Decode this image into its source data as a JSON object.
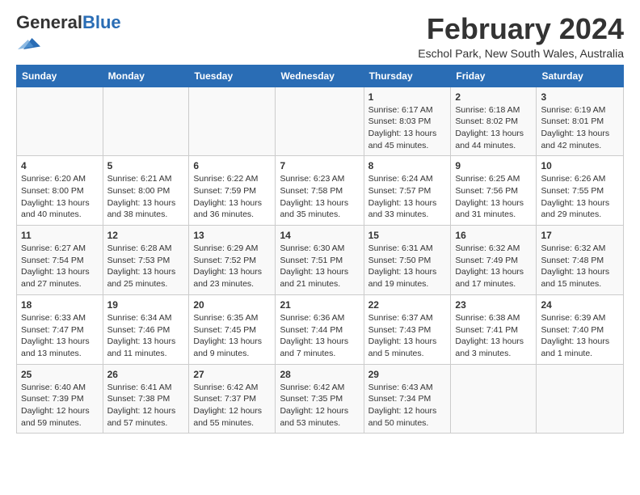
{
  "logo": {
    "general": "General",
    "blue": "Blue"
  },
  "title": {
    "month": "February 2024",
    "location": "Eschol Park, New South Wales, Australia"
  },
  "headers": [
    "Sunday",
    "Monday",
    "Tuesday",
    "Wednesday",
    "Thursday",
    "Friday",
    "Saturday"
  ],
  "weeks": [
    [
      {
        "day": "",
        "info": ""
      },
      {
        "day": "",
        "info": ""
      },
      {
        "day": "",
        "info": ""
      },
      {
        "day": "",
        "info": ""
      },
      {
        "day": "1",
        "info": "Sunrise: 6:17 AM\nSunset: 8:03 PM\nDaylight: 13 hours\nand 45 minutes."
      },
      {
        "day": "2",
        "info": "Sunrise: 6:18 AM\nSunset: 8:02 PM\nDaylight: 13 hours\nand 44 minutes."
      },
      {
        "day": "3",
        "info": "Sunrise: 6:19 AM\nSunset: 8:01 PM\nDaylight: 13 hours\nand 42 minutes."
      }
    ],
    [
      {
        "day": "4",
        "info": "Sunrise: 6:20 AM\nSunset: 8:00 PM\nDaylight: 13 hours\nand 40 minutes."
      },
      {
        "day": "5",
        "info": "Sunrise: 6:21 AM\nSunset: 8:00 PM\nDaylight: 13 hours\nand 38 minutes."
      },
      {
        "day": "6",
        "info": "Sunrise: 6:22 AM\nSunset: 7:59 PM\nDaylight: 13 hours\nand 36 minutes."
      },
      {
        "day": "7",
        "info": "Sunrise: 6:23 AM\nSunset: 7:58 PM\nDaylight: 13 hours\nand 35 minutes."
      },
      {
        "day": "8",
        "info": "Sunrise: 6:24 AM\nSunset: 7:57 PM\nDaylight: 13 hours\nand 33 minutes."
      },
      {
        "day": "9",
        "info": "Sunrise: 6:25 AM\nSunset: 7:56 PM\nDaylight: 13 hours\nand 31 minutes."
      },
      {
        "day": "10",
        "info": "Sunrise: 6:26 AM\nSunset: 7:55 PM\nDaylight: 13 hours\nand 29 minutes."
      }
    ],
    [
      {
        "day": "11",
        "info": "Sunrise: 6:27 AM\nSunset: 7:54 PM\nDaylight: 13 hours\nand 27 minutes."
      },
      {
        "day": "12",
        "info": "Sunrise: 6:28 AM\nSunset: 7:53 PM\nDaylight: 13 hours\nand 25 minutes."
      },
      {
        "day": "13",
        "info": "Sunrise: 6:29 AM\nSunset: 7:52 PM\nDaylight: 13 hours\nand 23 minutes."
      },
      {
        "day": "14",
        "info": "Sunrise: 6:30 AM\nSunset: 7:51 PM\nDaylight: 13 hours\nand 21 minutes."
      },
      {
        "day": "15",
        "info": "Sunrise: 6:31 AM\nSunset: 7:50 PM\nDaylight: 13 hours\nand 19 minutes."
      },
      {
        "day": "16",
        "info": "Sunrise: 6:32 AM\nSunset: 7:49 PM\nDaylight: 13 hours\nand 17 minutes."
      },
      {
        "day": "17",
        "info": "Sunrise: 6:32 AM\nSunset: 7:48 PM\nDaylight: 13 hours\nand 15 minutes."
      }
    ],
    [
      {
        "day": "18",
        "info": "Sunrise: 6:33 AM\nSunset: 7:47 PM\nDaylight: 13 hours\nand 13 minutes."
      },
      {
        "day": "19",
        "info": "Sunrise: 6:34 AM\nSunset: 7:46 PM\nDaylight: 13 hours\nand 11 minutes."
      },
      {
        "day": "20",
        "info": "Sunrise: 6:35 AM\nSunset: 7:45 PM\nDaylight: 13 hours\nand 9 minutes."
      },
      {
        "day": "21",
        "info": "Sunrise: 6:36 AM\nSunset: 7:44 PM\nDaylight: 13 hours\nand 7 minutes."
      },
      {
        "day": "22",
        "info": "Sunrise: 6:37 AM\nSunset: 7:43 PM\nDaylight: 13 hours\nand 5 minutes."
      },
      {
        "day": "23",
        "info": "Sunrise: 6:38 AM\nSunset: 7:41 PM\nDaylight: 13 hours\nand 3 minutes."
      },
      {
        "day": "24",
        "info": "Sunrise: 6:39 AM\nSunset: 7:40 PM\nDaylight: 13 hours\nand 1 minute."
      }
    ],
    [
      {
        "day": "25",
        "info": "Sunrise: 6:40 AM\nSunset: 7:39 PM\nDaylight: 12 hours\nand 59 minutes."
      },
      {
        "day": "26",
        "info": "Sunrise: 6:41 AM\nSunset: 7:38 PM\nDaylight: 12 hours\nand 57 minutes."
      },
      {
        "day": "27",
        "info": "Sunrise: 6:42 AM\nSunset: 7:37 PM\nDaylight: 12 hours\nand 55 minutes."
      },
      {
        "day": "28",
        "info": "Sunrise: 6:42 AM\nSunset: 7:35 PM\nDaylight: 12 hours\nand 53 minutes."
      },
      {
        "day": "29",
        "info": "Sunrise: 6:43 AM\nSunset: 7:34 PM\nDaylight: 12 hours\nand 50 minutes."
      },
      {
        "day": "",
        "info": ""
      },
      {
        "day": "",
        "info": ""
      }
    ]
  ]
}
